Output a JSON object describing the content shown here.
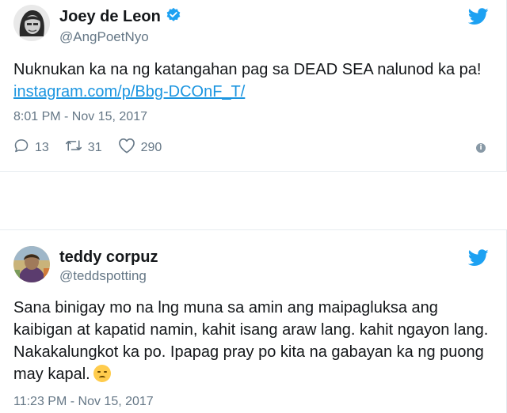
{
  "tweets": [
    {
      "name": "Joey de Leon",
      "handle": "@AngPoetNyo",
      "verified": true,
      "text_before_link": "Nuknukan ka na ng katangahan pag sa DEAD SEA nalunod ka pa! ",
      "link": "instagram.com/p/Bbg-DCOnF_T/",
      "timestamp": "8:01 PM - Nov 15, 2017",
      "replies": "13",
      "retweets": "31",
      "likes": "290",
      "avatar_icon": "avatar-photo",
      "platform_icon": "twitter-bird-icon"
    },
    {
      "name": "teddy corpuz",
      "handle": "@teddspotting",
      "text": "Sana binigay mo na lng muna sa amin ang maipagluksa ang kaibigan at kapatid namin, kahit isang araw lang. kahit ngayon lang. Nakakalungkot ka po. Ipapag pray po kita na gabayan ka ng puong may kapal.",
      "emoji": "pensive-face-emoji",
      "timestamp": "11:23 PM - Nov 15, 2017",
      "avatar_icon": "avatar-photo",
      "platform_icon": "twitter-bird-icon"
    }
  ],
  "colors": {
    "brand_blue": "#1da1f2",
    "link_blue": "#1b95e0",
    "muted_gray": "#657786",
    "text_dark": "#14171a"
  }
}
